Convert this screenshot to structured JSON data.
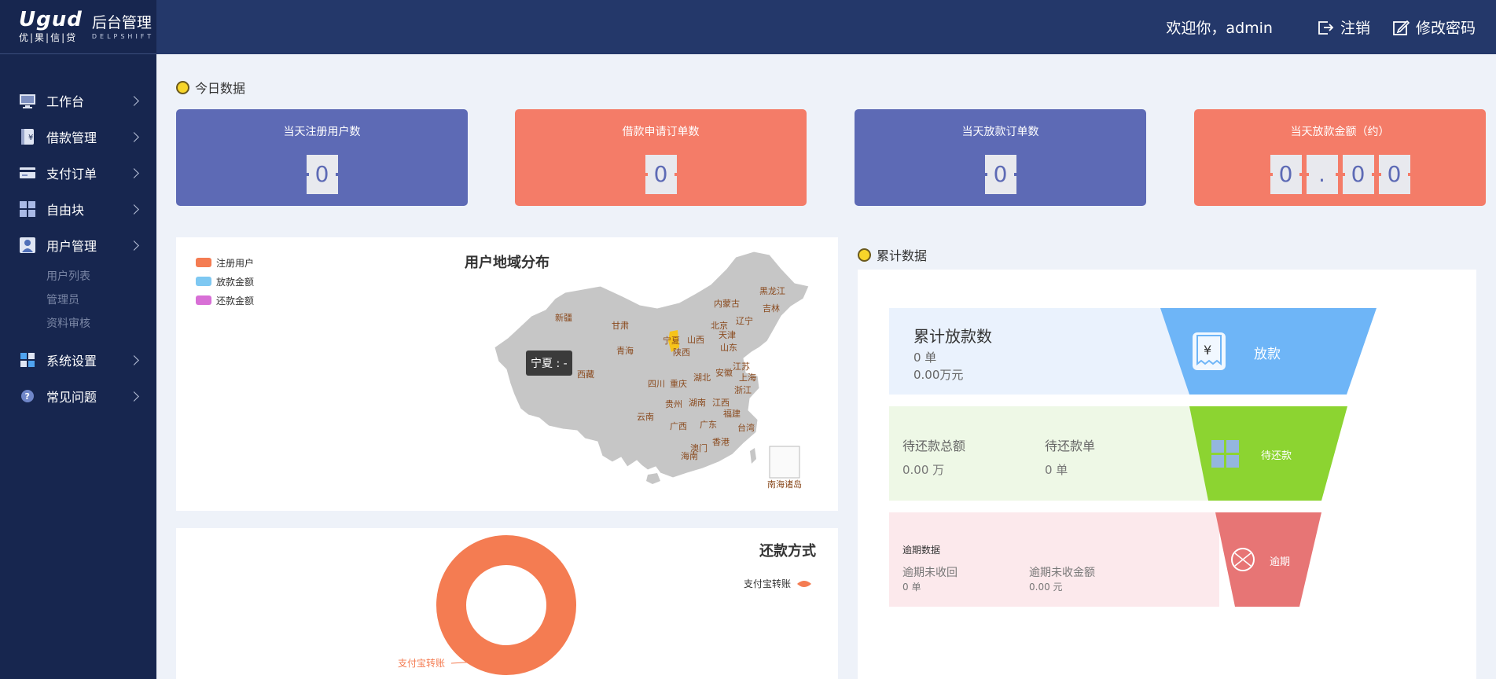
{
  "brand": {
    "logo": "Ugud",
    "logo_sub": "优|果|信|贷",
    "title": "后台管理",
    "subtitle": "DELPSHIFT"
  },
  "header": {
    "welcome": "欢迎你，admin",
    "logout": "注销",
    "change_password": "修改密码"
  },
  "sidebar": {
    "items": [
      {
        "label": "工作台",
        "icon": "monitor-icon"
      },
      {
        "label": "借款管理",
        "icon": "loan-book-icon"
      },
      {
        "label": "支付订单",
        "icon": "card-icon"
      },
      {
        "label": "自由块",
        "icon": "grid-icon"
      },
      {
        "label": "用户管理",
        "icon": "user-icon"
      },
      {
        "label": "系统设置",
        "icon": "windows-icon"
      },
      {
        "label": "常见问题",
        "icon": "question-icon"
      }
    ],
    "user_submenu": [
      "用户列表",
      "管理员",
      "资料审核"
    ]
  },
  "today": {
    "title": "今日数据",
    "cards": [
      {
        "label": "当天注册用户数",
        "digits": [
          "0"
        ],
        "color": "#5d6ab5"
      },
      {
        "label": "借款申请订单数",
        "digits": [
          "0"
        ],
        "color": "#f47c68"
      },
      {
        "label": "当天放款订单数",
        "digits": [
          "0"
        ],
        "color": "#5d6ab5"
      },
      {
        "label": "当天放款金额（约）",
        "digits": [
          "0",
          ".",
          "0",
          "0"
        ],
        "color": "#f47c68"
      }
    ]
  },
  "map": {
    "title": "用户地域分布",
    "legend": [
      {
        "label": "注册用户",
        "color": "#f47c52"
      },
      {
        "label": "放款金额",
        "color": "#7ec8f2"
      },
      {
        "label": "还款金额",
        "color": "#d86fd6"
      }
    ],
    "provinces": [
      "黑龙江",
      "吉林",
      "内蒙古",
      "辽宁",
      "新疆",
      "甘肃",
      "北京",
      "天津",
      "宁夏",
      "山西",
      "山东",
      "青海",
      "陕西",
      "江苏",
      "安徽",
      "上海",
      "西藏",
      "四川",
      "重庆",
      "湖北",
      "浙江",
      "贵州",
      "湖南",
      "江西",
      "云南",
      "广西",
      "广东",
      "福建",
      "台湾",
      "香港",
      "澳门",
      "海南",
      "南海诸岛"
    ],
    "tooltip": "宁夏 : -"
  },
  "repay": {
    "title": "还款方式",
    "series": [
      {
        "name": "支付宝转账",
        "color": "#f47c52"
      }
    ],
    "slice_label": "支付宝转账"
  },
  "cumulative": {
    "title": "累计数据",
    "loan": {
      "title": "累计放款数",
      "count": "0 单",
      "amount": "0.00万元",
      "tag": "放款",
      "color": "#6eb5f7"
    },
    "pending": {
      "total_label": "待还款总额",
      "total_value": "0.00 万",
      "orders_label": "待还款单",
      "orders_value": "0 单",
      "tag": "待还款",
      "color": "#8cd431"
    },
    "overdue": {
      "title": "逾期数据",
      "unrecovered_label": "逾期未收回",
      "unrecovered_value": "0 单",
      "unpaid_label": "逾期未收金额",
      "unpaid_value": "0.00 元",
      "tag": "逾期",
      "color": "#e77575"
    }
  }
}
